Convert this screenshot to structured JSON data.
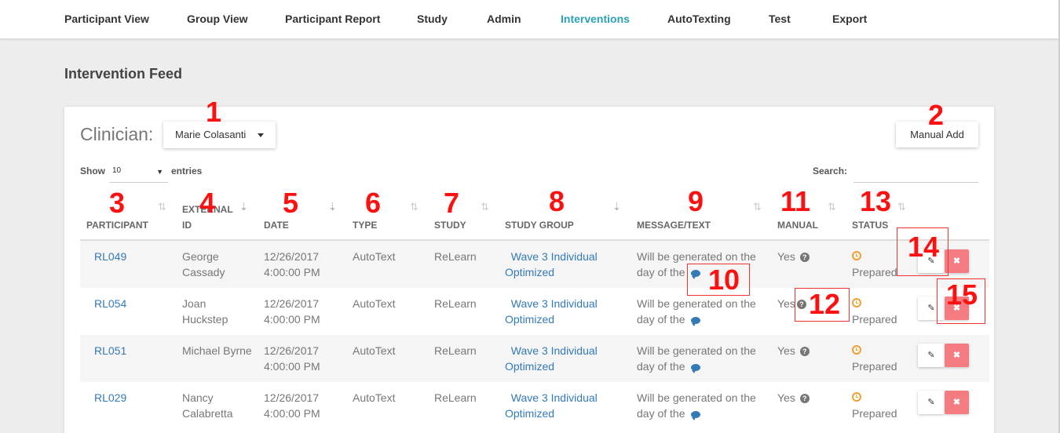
{
  "nav": {
    "items": [
      {
        "label": "Participant View"
      },
      {
        "label": "Group View"
      },
      {
        "label": "Participant Report"
      },
      {
        "label": "Study"
      },
      {
        "label": "Admin"
      },
      {
        "label": "Interventions",
        "active": true
      },
      {
        "label": "AutoTexting"
      },
      {
        "label": "Test"
      },
      {
        "label": "Export"
      }
    ]
  },
  "page": {
    "title": "Intervention Feed"
  },
  "clinician": {
    "label": "Clinician:",
    "selected": "Marie Colasanti"
  },
  "manual_add_label": "Manual Add",
  "table_controls": {
    "show_label": "Show",
    "entries_value": "10",
    "entries_label": "entries",
    "search_label": "Search:"
  },
  "table": {
    "headers": {
      "participant": "PARTICIPANT",
      "external_1": "EXTERNAL",
      "external_2": "ID",
      "date": "DATE",
      "type": "TYPE",
      "study": "STUDY",
      "study_group": "STUDY GROUP",
      "message": "MESSAGE/TEXT",
      "manual": "MANUAL",
      "status": "STATUS"
    },
    "rows": [
      {
        "participant": "RL049",
        "ext1": "George",
        "ext2": "Cassady",
        "date1": "12/26/2017",
        "date2": "4:00:00 PM",
        "type": "AutoText",
        "study": "ReLearn",
        "group1": "Wave 3 Individual",
        "group2": "Optimized",
        "msg1": "Will be generated on the",
        "msg2": "day of the",
        "manual": "Yes",
        "status": "Prepared"
      },
      {
        "participant": "RL054",
        "ext1": "Joan",
        "ext2": "Huckstep",
        "date1": "12/26/2017",
        "date2": "4:00:00 PM",
        "type": "AutoText",
        "study": "ReLearn",
        "group1": "Wave 3 Individual",
        "group2": "Optimized",
        "msg1": "Will be generated on the",
        "msg2": "day of the",
        "manual": "Yes",
        "status": "Prepared"
      },
      {
        "participant": "RL051",
        "ext1": "Michael Byrne",
        "ext2": "",
        "date1": "12/26/2017",
        "date2": "4:00:00 PM",
        "type": "AutoText",
        "study": "ReLearn",
        "group1": "Wave 3 Individual",
        "group2": "Optimized",
        "msg1": "Will be generated on the",
        "msg2": "day of the",
        "manual": "Yes",
        "status": "Prepared"
      },
      {
        "participant": "RL029",
        "ext1": "Nancy",
        "ext2": "Calabretta",
        "date1": "12/26/2017",
        "date2": "4:00:00 PM",
        "type": "AutoText",
        "study": "ReLearn",
        "group1": "Wave 3 Individual",
        "group2": "Optimized",
        "msg1": "Will be generated on the",
        "msg2": "day of the",
        "manual": "Yes",
        "status": "Prepared"
      }
    ]
  },
  "annotations": [
    "1",
    "2",
    "3",
    "4",
    "5",
    "6",
    "7",
    "8",
    "9",
    "10",
    "11",
    "12",
    "13",
    "14",
    "15"
  ],
  "colors": {
    "accent": "#2ba1b3",
    "link": "#337ab7",
    "delete": "#f47b80",
    "status": "#f0a030",
    "annotation": "#ff1010"
  },
  "icons": {
    "sort": "sort-icon",
    "chat": "chat-bubble-icon",
    "help": "question-circle-icon",
    "clock": "clock-icon",
    "edit": "edit-icon",
    "delete": "delete-x-icon"
  }
}
